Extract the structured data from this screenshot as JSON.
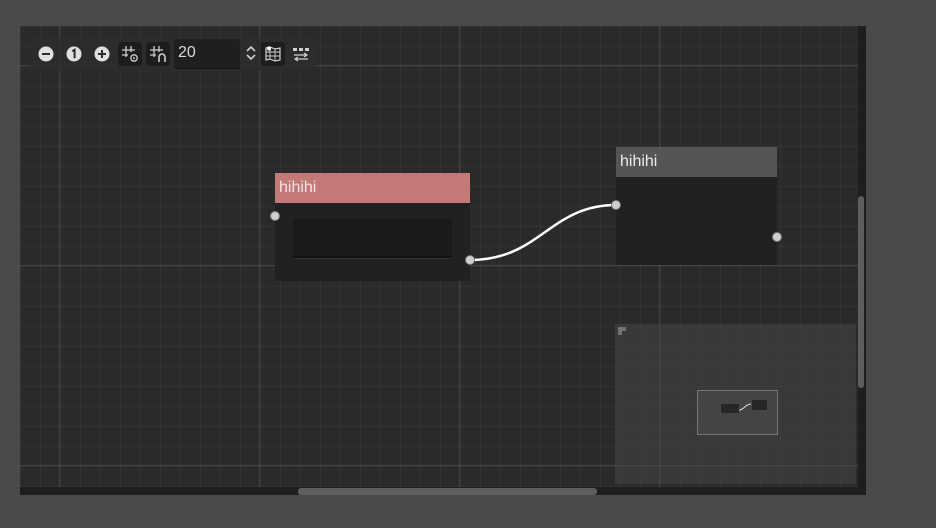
{
  "toolbar": {
    "zoom_out": "zoom-out-icon",
    "zoom_reset": "zoom-reset-icon",
    "zoom_in": "zoom-in-icon",
    "toggle_snap": "snap-grid-icon",
    "toggle_grid": "grid-icon",
    "snap_distance": "20",
    "toggle_minimap": "minimap-icon",
    "arrange_nodes": "arrange-nodes-icon"
  },
  "nodes": [
    {
      "title": "hihihi",
      "selected": true,
      "title_color": "#c57878"
    },
    {
      "title": "hihihi",
      "selected": false,
      "title_color": "#555555"
    }
  ],
  "colors": {
    "background": "#4a4a4a",
    "grid": "#2a2a2a",
    "connection": "#ffffff",
    "port": "#cfcfcf"
  }
}
